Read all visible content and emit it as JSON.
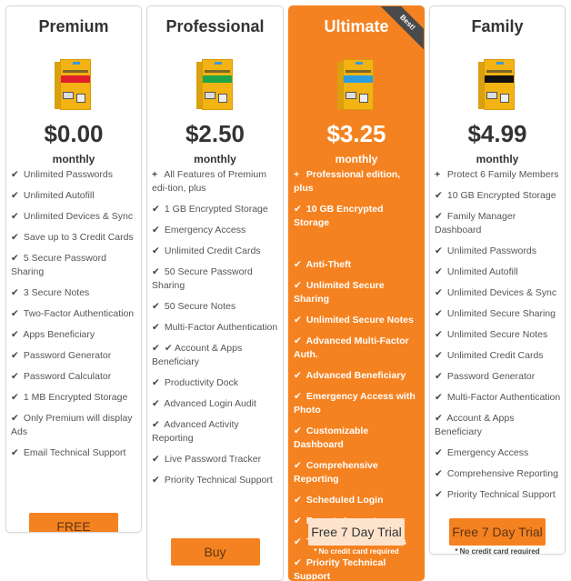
{
  "plans": [
    {
      "name": "Premium",
      "box_label": "Premium",
      "box_band_color": "#e0202a",
      "price": "$0.00",
      "period": "monthly",
      "features": [
        {
          "icon": "check",
          "text": "Unlimited Passwords"
        },
        {
          "icon": "check",
          "text": "Unlimited Autofill"
        },
        {
          "icon": "check",
          "text": "Unlimited Devices & Sync"
        },
        {
          "icon": "check",
          "text": "Save up to 3 Credit Cards"
        },
        {
          "icon": "check",
          "text": "5 Secure Password Sharing"
        },
        {
          "icon": "check",
          "text": "3 Secure Notes"
        },
        {
          "icon": "check",
          "text": "Two-Factor Authentication"
        },
        {
          "icon": "check",
          "text": "Apps Beneficiary"
        },
        {
          "icon": "check",
          "text": "Password Generator"
        },
        {
          "icon": "check",
          "text": "Password Calculator"
        },
        {
          "icon": "check",
          "text": "1 MB Encrypted Storage"
        },
        {
          "icon": "check",
          "text": "Only Premium will display Ads"
        },
        {
          "icon": "check",
          "text": "Email Technical Support"
        }
      ],
      "cta_label": "FREE",
      "note": ""
    },
    {
      "name": "Professional",
      "box_label": "Professional",
      "box_band_color": "#1fa64a",
      "price": "$2.50",
      "period": "monthly",
      "features": [
        {
          "icon": "plus",
          "text": "All Features of Premium edi-tion, plus"
        },
        {
          "icon": "check",
          "text": "1 GB Encrypted Storage"
        },
        {
          "icon": "check",
          "text": "Emergency Access"
        },
        {
          "icon": "check",
          "text": "Unlimited Credit Cards"
        },
        {
          "icon": "check",
          "text": "50 Secure Password Sharing"
        },
        {
          "icon": "check",
          "text": "50 Secure Notes"
        },
        {
          "icon": "check",
          "text": "Multi-Factor Authentication"
        },
        {
          "icon": "check",
          "text": "✔ Account & Apps Beneficiary"
        },
        {
          "icon": "check",
          "text": "Productivity Dock"
        },
        {
          "icon": "check",
          "text": "Advanced Login Audit"
        },
        {
          "icon": "check",
          "text": "Advanced Activity Reporting"
        },
        {
          "icon": "check",
          "text": "Live Password Tracker"
        },
        {
          "icon": "check",
          "text": "Priority Technical Support"
        }
      ],
      "cta_label": "Buy",
      "note": ""
    },
    {
      "name": "Ultimate",
      "badge": "Best!",
      "box_label": "Ultimate",
      "box_band_color": "#2a9ee0",
      "price": "$3.25",
      "period": "monthly",
      "features": [
        {
          "icon": "plus",
          "text": "Professional edition, plus"
        },
        {
          "icon": "check",
          "text": "10 GB Encrypted Storage"
        },
        {
          "icon": "check",
          "text": "Anti-Theft"
        },
        {
          "icon": "check",
          "text": "Unlimited Secure Sharing"
        },
        {
          "icon": "check",
          "text": "Unlimited Secure Notes"
        },
        {
          "icon": "check",
          "text": "Advanced Multi-Factor Auth."
        },
        {
          "icon": "check",
          "text": "Advanced Beneficiary"
        },
        {
          "icon": "check",
          "text": "Emergency Access with Photo"
        },
        {
          "icon": "check",
          "text": "Customizable Dashboard"
        },
        {
          "icon": "check",
          "text": "Comprehensive Reporting"
        },
        {
          "icon": "check",
          "text": "Scheduled Login"
        },
        {
          "icon": "check",
          "text": "Remote Logout"
        },
        {
          "icon": "check",
          "text": "Tons of other features"
        },
        {
          "icon": "check",
          "text": "Priority Technical Support"
        }
      ],
      "cta_label": "Free 7 Day Trial",
      "note": "* No credit card required"
    },
    {
      "name": "Family",
      "box_label": "Family Edition",
      "box_band_color": "#111111",
      "price": "$4.99",
      "period": "monthly",
      "features": [
        {
          "icon": "plus",
          "text": "Protect 6 Family Members"
        },
        {
          "icon": "check",
          "text": "10 GB Encrypted Storage"
        },
        {
          "icon": "check",
          "text": "Family Manager Dashboard"
        },
        {
          "icon": "check",
          "text": "Unlimited Passwords"
        },
        {
          "icon": "check",
          "text": "Unlimited Autofill"
        },
        {
          "icon": "check",
          "text": "Unlimited Devices & Sync"
        },
        {
          "icon": "check",
          "text": "Unlimited Secure Sharing"
        },
        {
          "icon": "check",
          "text": "Unlimited Secure Notes"
        },
        {
          "icon": "check",
          "text": "Unlimited Credit Cards"
        },
        {
          "icon": "check",
          "text": "Password Generator"
        },
        {
          "icon": "check",
          "text": "Multi-Factor Authentication"
        },
        {
          "icon": "check",
          "text": "Account & Apps Beneficiary"
        },
        {
          "icon": "check",
          "text": "Emergency Access"
        },
        {
          "icon": "check",
          "text": "Comprehensive Reporting"
        },
        {
          "icon": "check",
          "text": "Priority Technical Support"
        }
      ],
      "cta_label": "Free 7 Day Trial",
      "note": "* No credit card required"
    }
  ],
  "colors": {
    "accent": "#f58220",
    "highlight_button": "#fde3cc",
    "ribbon": "#4a4a4a"
  }
}
